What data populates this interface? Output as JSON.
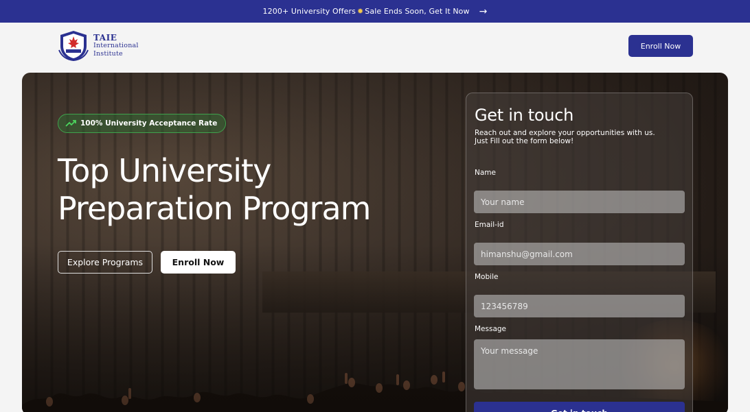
{
  "promo": {
    "text_before": "1200+ University Offers",
    "text_after": "Sale Ends Soon, Get It Now",
    "sparkle_icon": "sparkle-emoji-icon",
    "arrow_icon": "arrow-right-icon"
  },
  "header": {
    "logo": {
      "line1": "TAIE",
      "line2": "International",
      "line3": "Institute",
      "icon": "crest-logo-icon"
    },
    "enroll_label": "Enroll Now"
  },
  "hero": {
    "badge": "100% University Acceptance Rate",
    "badge_icon": "trending-up-icon",
    "title_line1": "Top University",
    "title_line2": "Preparation Program",
    "explore_label": "Explore Programs",
    "enroll_label": "Enroll Now"
  },
  "form": {
    "title": "Get in touch",
    "subtitle_line1": "Reach out and explore your opportunities with us.",
    "subtitle_line2": "Just Fill out the form below!",
    "name_label": "Name",
    "name_placeholder": "Your name",
    "email_label": "Email-id",
    "email_placeholder": "himanshu@gmail.com",
    "mobile_label": "Mobile",
    "mobile_placeholder": "123456789",
    "message_label": "Message",
    "message_placeholder": "Your message",
    "submit_label": "Get in touch"
  },
  "colors": {
    "brand": "#2b3191",
    "badge_green": "#3fa34d"
  }
}
